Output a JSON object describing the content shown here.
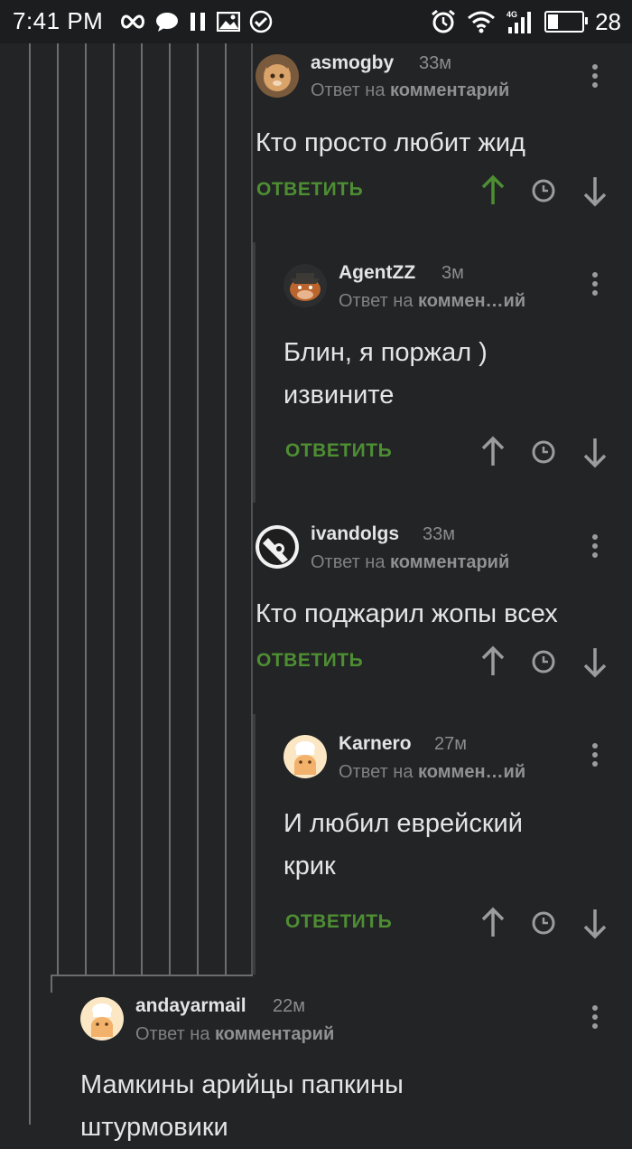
{
  "status_bar": {
    "time": "7:41 PM",
    "battery": "28",
    "battery_level_percent": 28,
    "icons_left": [
      "infinity-icon",
      "chat-bubble-icon",
      "pause-icon",
      "image-icon",
      "check-circle-icon"
    ],
    "icons_right": [
      "alarm-icon",
      "wifi-icon",
      "signal-4g-icon",
      "battery-icon"
    ]
  },
  "colors": {
    "background": "#222425",
    "reply_green": "#4e8e33",
    "upvoted_green": "#4e8e33",
    "muted": "#8a8c8d"
  },
  "comments": [
    {
      "username": "asmogby",
      "time": "33м",
      "reply_prefix": "Ответ на",
      "reply_target": "комментарий",
      "text_lines": [
        "Кто просто любит жид"
      ],
      "reply_label": "ОТВЕТИТЬ",
      "upvoted": true
    },
    {
      "username": "AgentZZ",
      "time": "3м",
      "reply_prefix": "Ответ на",
      "reply_target": "коммен…ий",
      "text_lines": [
        "Блин, я поржал )",
        "извините"
      ],
      "reply_label": "ОТВЕТИТЬ",
      "upvoted": false
    },
    {
      "username": "ivandolgs",
      "time": "33м",
      "reply_prefix": "Ответ на",
      "reply_target": "комментарий",
      "text_lines": [
        "Кто поджарил жопы всех"
      ],
      "reply_label": "ОТВЕТИТЬ",
      "upvoted": false
    },
    {
      "username": "Karnero",
      "time": "27м",
      "reply_prefix": "Ответ на",
      "reply_target": "коммен…ий",
      "text_lines": [
        "И любил еврейский",
        "крик"
      ],
      "reply_label": "ОТВЕТИТЬ",
      "upvoted": false
    },
    {
      "username": "andayarmail",
      "time": "22м",
      "reply_prefix": "Ответ на",
      "reply_target": "комментарий",
      "text_lines": [
        "Мамкины арийцы папкины",
        "штурмовики"
      ]
    }
  ]
}
